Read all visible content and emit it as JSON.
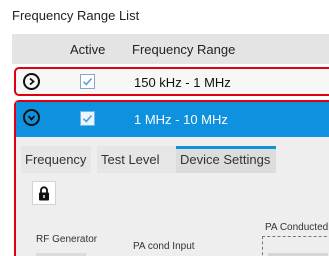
{
  "title": "Frequency Range List",
  "table": {
    "columns": {
      "active": "Active",
      "range": "Frequency Range"
    },
    "rows": [
      {
        "range": "150 kHz - 1 MHz",
        "active": true,
        "expanded": false
      },
      {
        "range": "1 MHz - 10 MHz",
        "active": true,
        "expanded": true
      }
    ]
  },
  "detail": {
    "tabs": [
      "Frequency",
      "Test Level",
      "Device Settings"
    ],
    "active_tab": "Device Settings",
    "labels": {
      "rf_generator": "RF Generator",
      "pa_cond_input": "PA cond Input",
      "pa_conducted": "PA Conducted"
    }
  },
  "icons": {
    "expand_collapsed": "chevron-right-icon",
    "expand_expanded": "chevron-down-icon",
    "checkbox": "checkmark-icon",
    "lock": "lock-icon"
  },
  "colors": {
    "selection_blue": "#0e92df",
    "highlight_red": "#e0000f",
    "header_gray": "#e4e4e4",
    "panel_gray": "#eeeeee"
  }
}
